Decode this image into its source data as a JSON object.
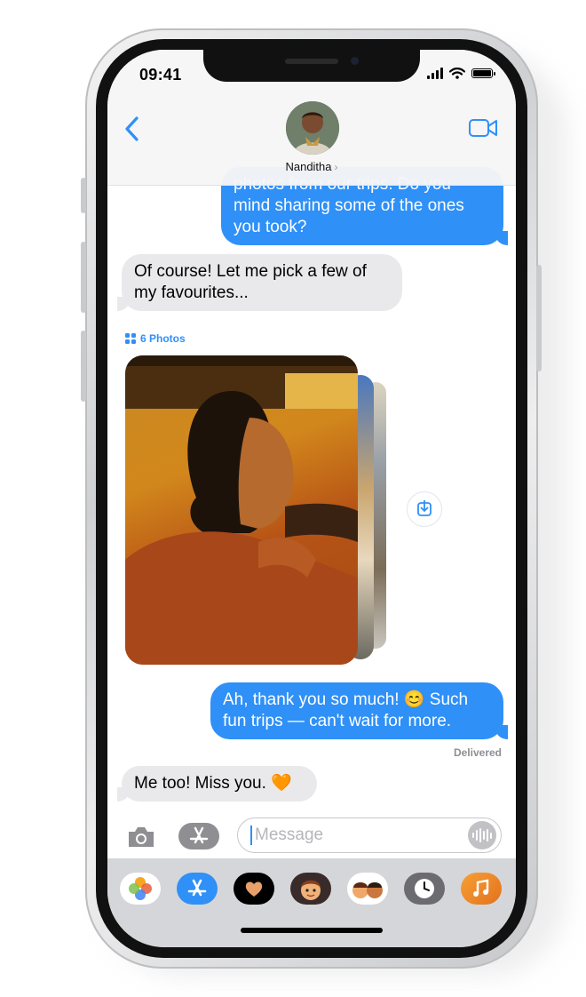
{
  "status_bar": {
    "time": "09:41"
  },
  "header": {
    "contact_name": "Nanditha",
    "chevron": "›",
    "back_icon": "chevron-left-icon",
    "video_icon": "video-camera-icon"
  },
  "messages": [
    {
      "direction": "outgoing",
      "text": "photos from our trips. Do you mind sharing some of the ones you took?"
    },
    {
      "direction": "incoming",
      "text": "Of course! Let me pick a few of my favourites..."
    },
    {
      "direction": "outgoing",
      "text": "Ah, thank you so much! 😊 Such fun trips — can't wait for more."
    },
    {
      "direction": "incoming",
      "text": "Me too! Miss you. 🧡"
    }
  ],
  "photo_stack": {
    "label": "6 Photos",
    "save_icon": "save-to-library-icon"
  },
  "delivered_label": "Delivered",
  "composer": {
    "placeholder": "Message"
  },
  "app_drawer": {
    "apps": [
      "photos",
      "app-store",
      "digital-touch",
      "memoji",
      "memoji-stickers",
      "clock",
      "music"
    ]
  },
  "colors": {
    "accent": "#2f90f7",
    "incoming_bubble": "#e9e9eb",
    "drawer": "#d5d6d9"
  }
}
